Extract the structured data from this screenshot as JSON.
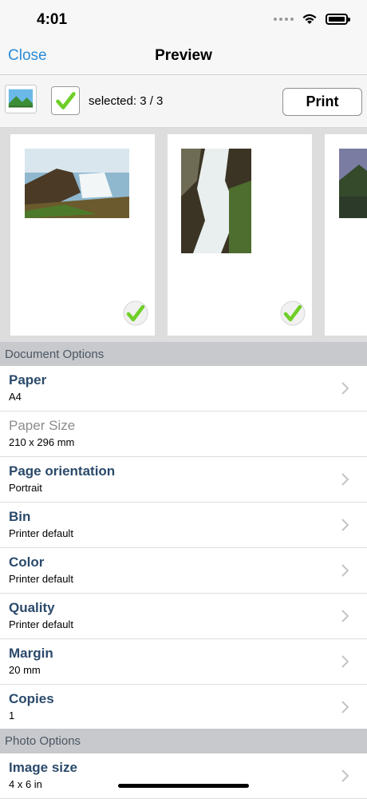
{
  "status_bar": {
    "time": "4:01",
    "icons": [
      "cellular-icon",
      "wifi-icon",
      "battery-icon"
    ]
  },
  "nav": {
    "close_label": "Close",
    "title": "Preview"
  },
  "toolbar": {
    "photo_icon": "photo-icon",
    "selection_text": "selected: 3 / 3",
    "print_label": "Print"
  },
  "preview": {
    "pages": [
      {
        "name": "waterfall-landscape",
        "selected": true
      },
      {
        "name": "waterfall-portrait",
        "selected": true
      },
      {
        "name": "mountain-lake",
        "selected": true
      }
    ]
  },
  "document_options": {
    "header": "Document Options",
    "rows": [
      {
        "title": "Paper",
        "value": "A4",
        "enabled": true
      },
      {
        "title": "Paper Size",
        "value": "210 x 296 mm",
        "enabled": false
      },
      {
        "title": "Page orientation",
        "value": "Portrait",
        "enabled": true
      },
      {
        "title": "Bin",
        "value": "Printer default",
        "enabled": true
      },
      {
        "title": "Color",
        "value": "Printer default",
        "enabled": true
      },
      {
        "title": "Quality",
        "value": "Printer default",
        "enabled": true
      },
      {
        "title": "Margin",
        "value": "20 mm",
        "enabled": true
      },
      {
        "title": "Copies",
        "value": "1",
        "enabled": true
      }
    ]
  },
  "photo_options": {
    "header": "Photo Options",
    "rows": [
      {
        "title": "Image size",
        "value": "4 x 6 in",
        "enabled": true
      }
    ]
  },
  "colors": {
    "accent": "#2a8bd6",
    "row_title": "#2b4a6b",
    "section_bg": "#c7c9cc",
    "check_green": "#6fcf28"
  }
}
